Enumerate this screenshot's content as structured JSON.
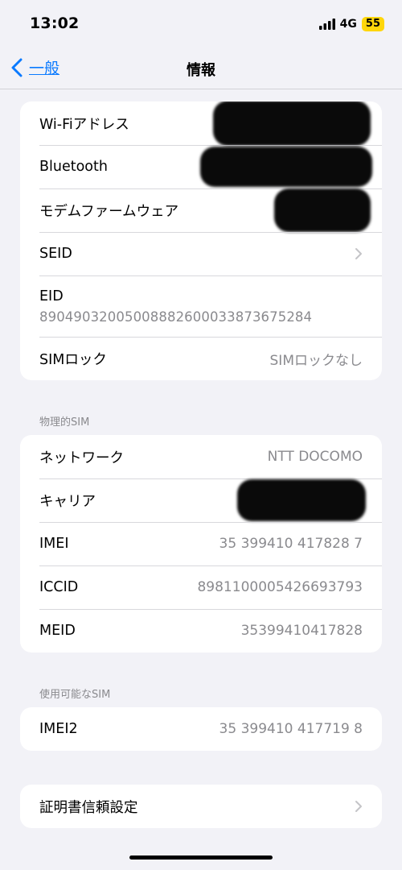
{
  "status_bar": {
    "time": "13:02",
    "network": "4G",
    "battery": "55"
  },
  "nav": {
    "back_label": "一般",
    "title": "情報"
  },
  "group1": {
    "rows": [
      {
        "label": "Wi-Fiアドレス",
        "value": "[redacted]"
      },
      {
        "label": "Bluetooth",
        "value": "[redacted]"
      },
      {
        "label": "モデムファームウェア",
        "value": "[redacted]"
      },
      {
        "label": "SEID"
      },
      {
        "label": "EID",
        "value": "89049032005008882600033873675284"
      },
      {
        "label": "SIMロック",
        "value": "SIMロックなし"
      }
    ]
  },
  "physical_sim": {
    "header": "物理的SIM",
    "rows": [
      {
        "label": "ネットワーク",
        "value": "NTT DOCOMO"
      },
      {
        "label": "キャリア",
        "value": "[redacted]"
      },
      {
        "label": "IMEI",
        "value": "35 399410 417828 7"
      },
      {
        "label": "ICCID",
        "value": "8981100005426693793"
      },
      {
        "label": "MEID",
        "value": "35399410417828"
      }
    ]
  },
  "available_sim": {
    "header": "使用可能なSIM",
    "rows": [
      {
        "label": "IMEI2",
        "value": "35 399410 417719 8"
      }
    ]
  },
  "certificate": {
    "label": "証明書信頼設定"
  },
  "colors": {
    "accent": "#0a7aff",
    "background": "#f2f2f7",
    "secondary_text": "#8a8a8e",
    "battery": "#ffd60a"
  }
}
